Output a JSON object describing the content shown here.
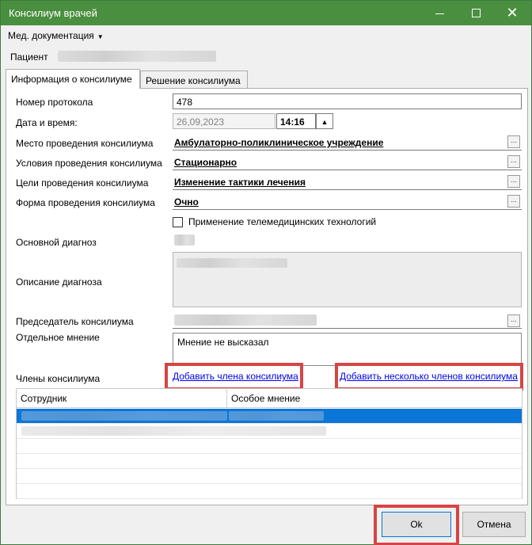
{
  "window": {
    "title": "Консилиум врачей",
    "colors": {
      "titlebar": "#4a8f3f",
      "selection": "#0a76d8",
      "highlight": "#d64545",
      "link": "#0000ee"
    }
  },
  "menu": {
    "label": "Мед. документация"
  },
  "patient": {
    "label": "Пациент"
  },
  "tabs": [
    {
      "label": "Информация о консилиуме",
      "active": true
    },
    {
      "label": "Решение консилиума",
      "active": false
    }
  ],
  "form": {
    "protocol": {
      "label": "Номер протокола",
      "value": "478"
    },
    "datetime": {
      "label": "Дата и время:",
      "date": "26,09,2023",
      "time": "14:16"
    },
    "place": {
      "label": "Место проведения консилиума",
      "value": "Амбулаторно-поликлиническое учреждение"
    },
    "conditions": {
      "label": "Условия проведения консилиума",
      "value": "Стационарно"
    },
    "goals": {
      "label": "Цели проведения консилиума",
      "value": "Изменение тактики лечения"
    },
    "form_type": {
      "label": "Форма проведения консилиума",
      "value": "Очно"
    },
    "telemed": {
      "label": "Применение телемедицинских технологий",
      "checked": false
    },
    "main_diagnosis": {
      "label": "Основной диагноз"
    },
    "diagnosis_desc": {
      "label": "Описание диагноза"
    },
    "chairman": {
      "label": "Председатель консилиума"
    },
    "separate_opinion": {
      "label": "Отдельное мнение",
      "value": "Мнение не высказал"
    },
    "members": {
      "label": "Члены консилиума",
      "add_one": "Добавить члена консилиума",
      "add_many": "Добавить несколько членов консилиума"
    }
  },
  "grid": {
    "columns": [
      "Сотрудник",
      "Особое мнение"
    ]
  },
  "buttons": {
    "ok": "Ok",
    "cancel": "Отмена"
  }
}
